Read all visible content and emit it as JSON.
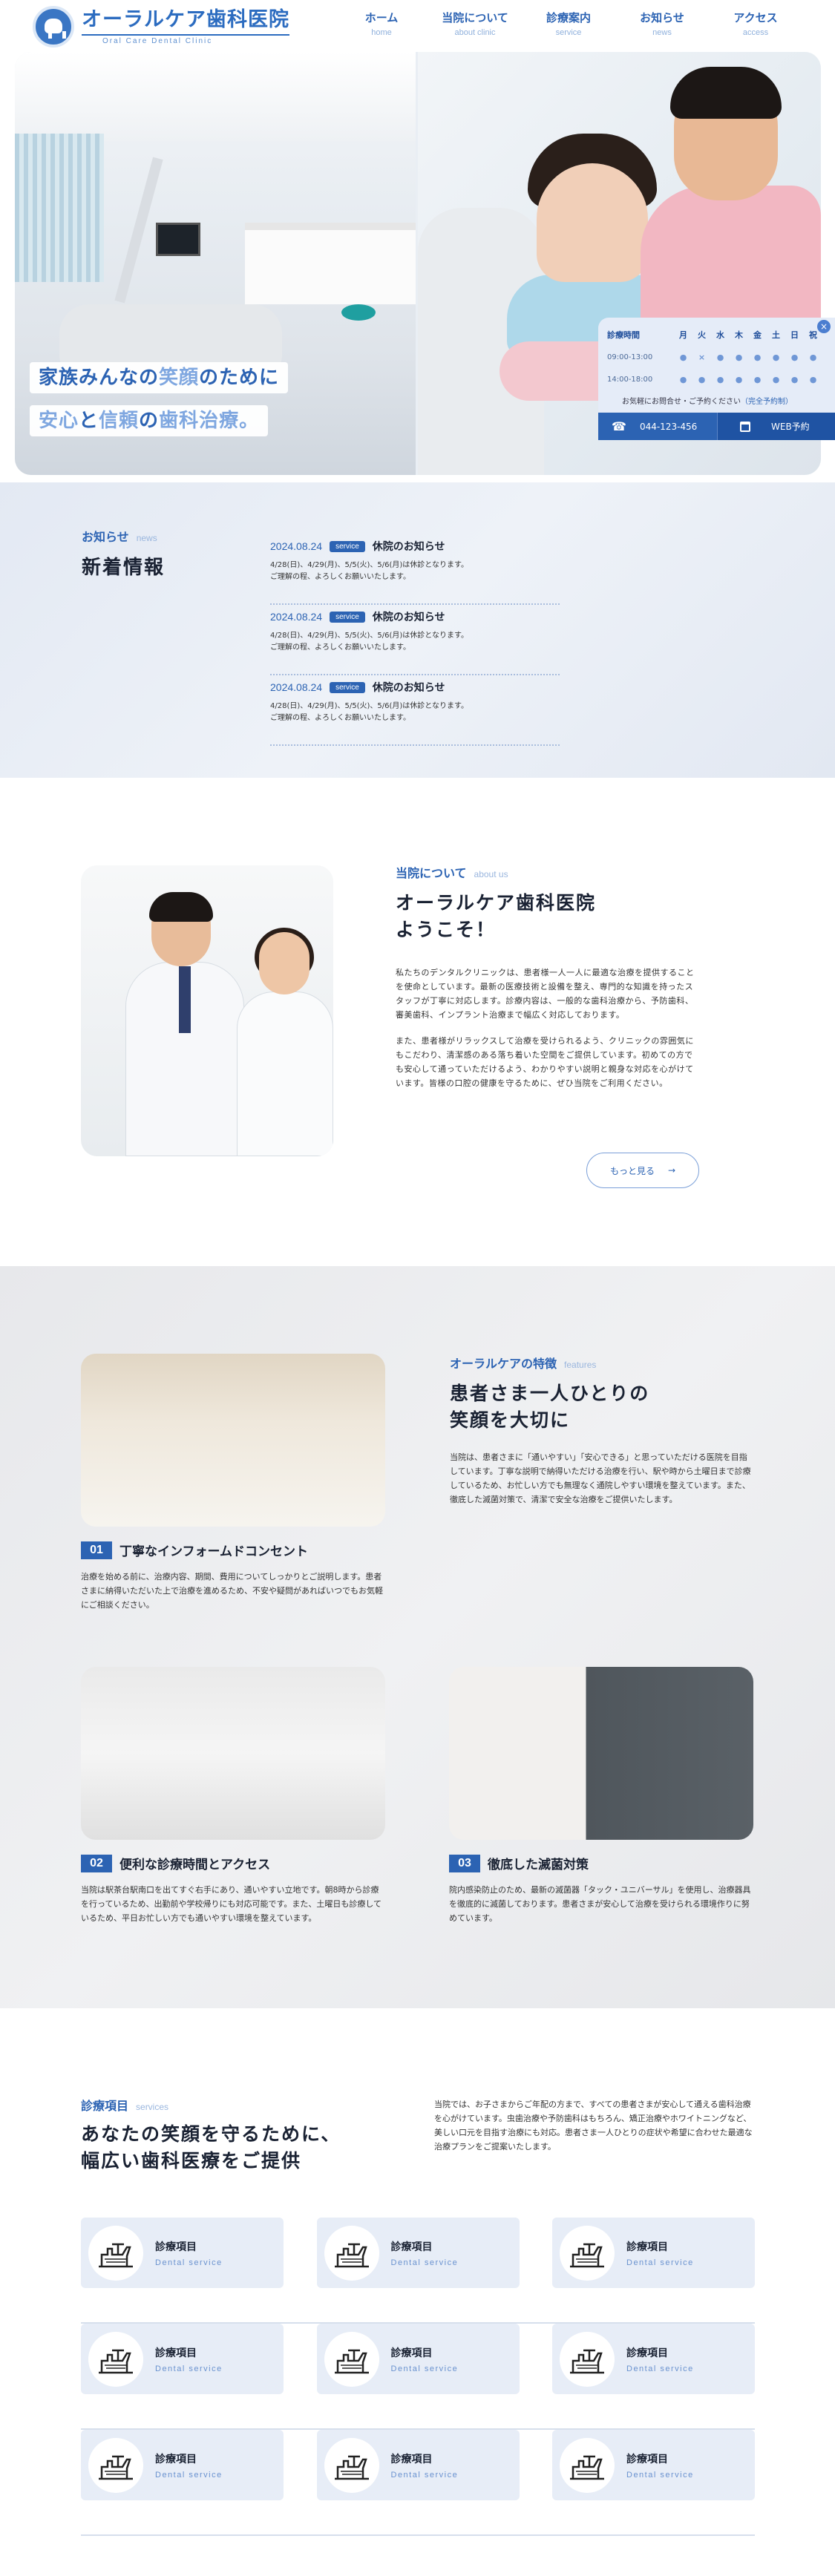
{
  "header": {
    "logo_title": "オーラルケア歯科医院",
    "logo_sub": "Oral Care Dental Clinic",
    "nav": [
      {
        "jp": "ホーム",
        "en": "home"
      },
      {
        "jp": "当院について",
        "en": "about clinic"
      },
      {
        "jp": "診療案内",
        "en": "service"
      },
      {
        "jp": "お知らせ",
        "en": "news"
      },
      {
        "jp": "アクセス",
        "en": "access"
      }
    ]
  },
  "hero": {
    "tagline1_a": "家族みんなの",
    "tagline1_b": "笑顔",
    "tagline1_c": "のために",
    "tagline2_a": "安心",
    "tagline2_b": "と",
    "tagline2_c": "信頼",
    "tagline2_d": "の",
    "tagline2_e": "歯科治療。"
  },
  "hours": {
    "label": "診療時間",
    "days": [
      "月",
      "火",
      "水",
      "木",
      "金",
      "土",
      "日",
      "祝"
    ],
    "rows": [
      {
        "time": "09:00-13:00",
        "marks": [
          "●",
          "×",
          "●",
          "●",
          "●",
          "●",
          "●",
          "●"
        ]
      },
      {
        "time": "14:00-18:00",
        "marks": [
          "●",
          "●",
          "●",
          "●",
          "●",
          "●",
          "●",
          "●"
        ]
      }
    ],
    "note_a": "お気軽にお問合せ・ご予約ください",
    "note_b": "（完全予約制）",
    "tel": "044-123-456",
    "web": "WEB予約",
    "close_icon": "×",
    "accent_color": "#2c63b3"
  },
  "news": {
    "label": "お知らせ",
    "label_en": "news",
    "title": "新着情報",
    "items": [
      {
        "date": "2024.08.24",
        "badge": "service",
        "title": "休院のお知らせ",
        "body1": "4/28(日)、4/29(月)、5/5(火)、5/6(月)は休診となります。",
        "body2": "ご理解の程、よろしくお願いいたします。"
      },
      {
        "date": "2024.08.24",
        "badge": "service",
        "title": "休院のお知らせ",
        "body1": "4/28(日)、4/29(月)、5/5(火)、5/6(月)は休診となります。",
        "body2": "ご理解の程、よろしくお願いいたします。"
      },
      {
        "date": "2024.08.24",
        "badge": "service",
        "title": "休院のお知らせ",
        "body1": "4/28(日)、4/29(月)、5/5(火)、5/6(月)は休診となります。",
        "body2": "ご理解の程、よろしくお願いいたします。"
      }
    ]
  },
  "about": {
    "label": "当院について",
    "label_en": "about us",
    "title1": "オーラルケア歯科医院",
    "title2": "ようこそ！",
    "p1": "私たちのデンタルクリニックは、患者様一人一人に最適な治療を提供することを使命としています。最新の医療技術と設備を整え、専門的な知識を持ったスタッフが丁寧に対応します。診療内容は、一般的な歯科治療から、予防歯科、審美歯科、インプラント治療まで幅広く対応しております。",
    "p2": "また、患者様がリラックスして治療を受けられるよう、クリニックの雰囲気にもこだわり、清潔感のある落ち着いた空間をご提供しています。初めての方でも安心して通っていただけるよう、わかりやすい説明と親身な対応を心がけています。皆様の口腔の健康を守るために、ぜひ当院をご利用ください。",
    "more": "もっと見る",
    "more_arrow": "→"
  },
  "features": {
    "label": "オーラルケアの特徴",
    "label_en": "features",
    "title1": "患者さま一人ひとりの",
    "title2": "笑顔を大切に",
    "body": "当院は、患者さまに「通いやすい」「安心できる」と思っていただける医院を目指しています。丁寧な説明で納得いただける治療を行い、駅や時から土曜日まで診療しているため、お忙しい方でも無理なく通院しやすい環境を整えています。また、徹底した滅菌対策で、清潔で安全な治療をご提供いたします。",
    "items": [
      {
        "num": "01",
        "title": "丁寧なインフォームドコンセント",
        "body": "治療を始める前に、治療内容、期間、費用についてしっかりとご説明します。患者さまに納得いただいた上で治療を進めるため、不安や疑問があればいつでもお気軽にご相談ください。"
      },
      {
        "num": "02",
        "title": "便利な診療時間とアクセス",
        "body": "当院は駅茶台駅南口を出てすぐ右手にあり、通いやすい立地です。朝8時から診療を行っているため、出勤前や学校帰りにも対応可能です。また、土曜日も診療しているため、平日お忙しい方でも通いやすい環境を整えています。"
      },
      {
        "num": "03",
        "title": "徹底した滅菌対策",
        "body": "院内感染防止のため、最新の滅菌器「タック・ユニバーサル」を使用し、治療器具を徹底的に滅菌しております。患者さまが安心して治療を受けられる環境作りに努めています。"
      }
    ]
  },
  "services": {
    "label": "診療項目",
    "label_en": "services",
    "title1": "あなたの笑顔を守るために、",
    "title2": "幅広い歯科医療をご提供",
    "intro": "当院では、お子さまからご年配の方まで、すべての患者さまが安心して通える歯科治療を心がけています。虫歯治療や予防歯科はもちろん、矯正治療やホワイトニングなど、美しい口元を目指す治療にも対応。患者さま一人ひとりの症状や希望に合わせた最適な治療プランをご提案いたします。",
    "rows": [
      [
        {
          "name": "診療項目",
          "en": "Dental service"
        },
        {
          "name": "診療項目",
          "en": "Dental service"
        },
        {
          "name": "診療項目",
          "en": "Dental service"
        }
      ],
      [
        {
          "name": "診療項目",
          "en": "Dental service"
        },
        {
          "name": "診療項目",
          "en": "Dental service"
        },
        {
          "name": "診療項目",
          "en": "Dental service"
        }
      ],
      [
        {
          "name": "診療項目",
          "en": "Dental service"
        },
        {
          "name": "診療項目",
          "en": "Dental service"
        },
        {
          "name": "診療項目",
          "en": "Dental service"
        }
      ]
    ]
  }
}
